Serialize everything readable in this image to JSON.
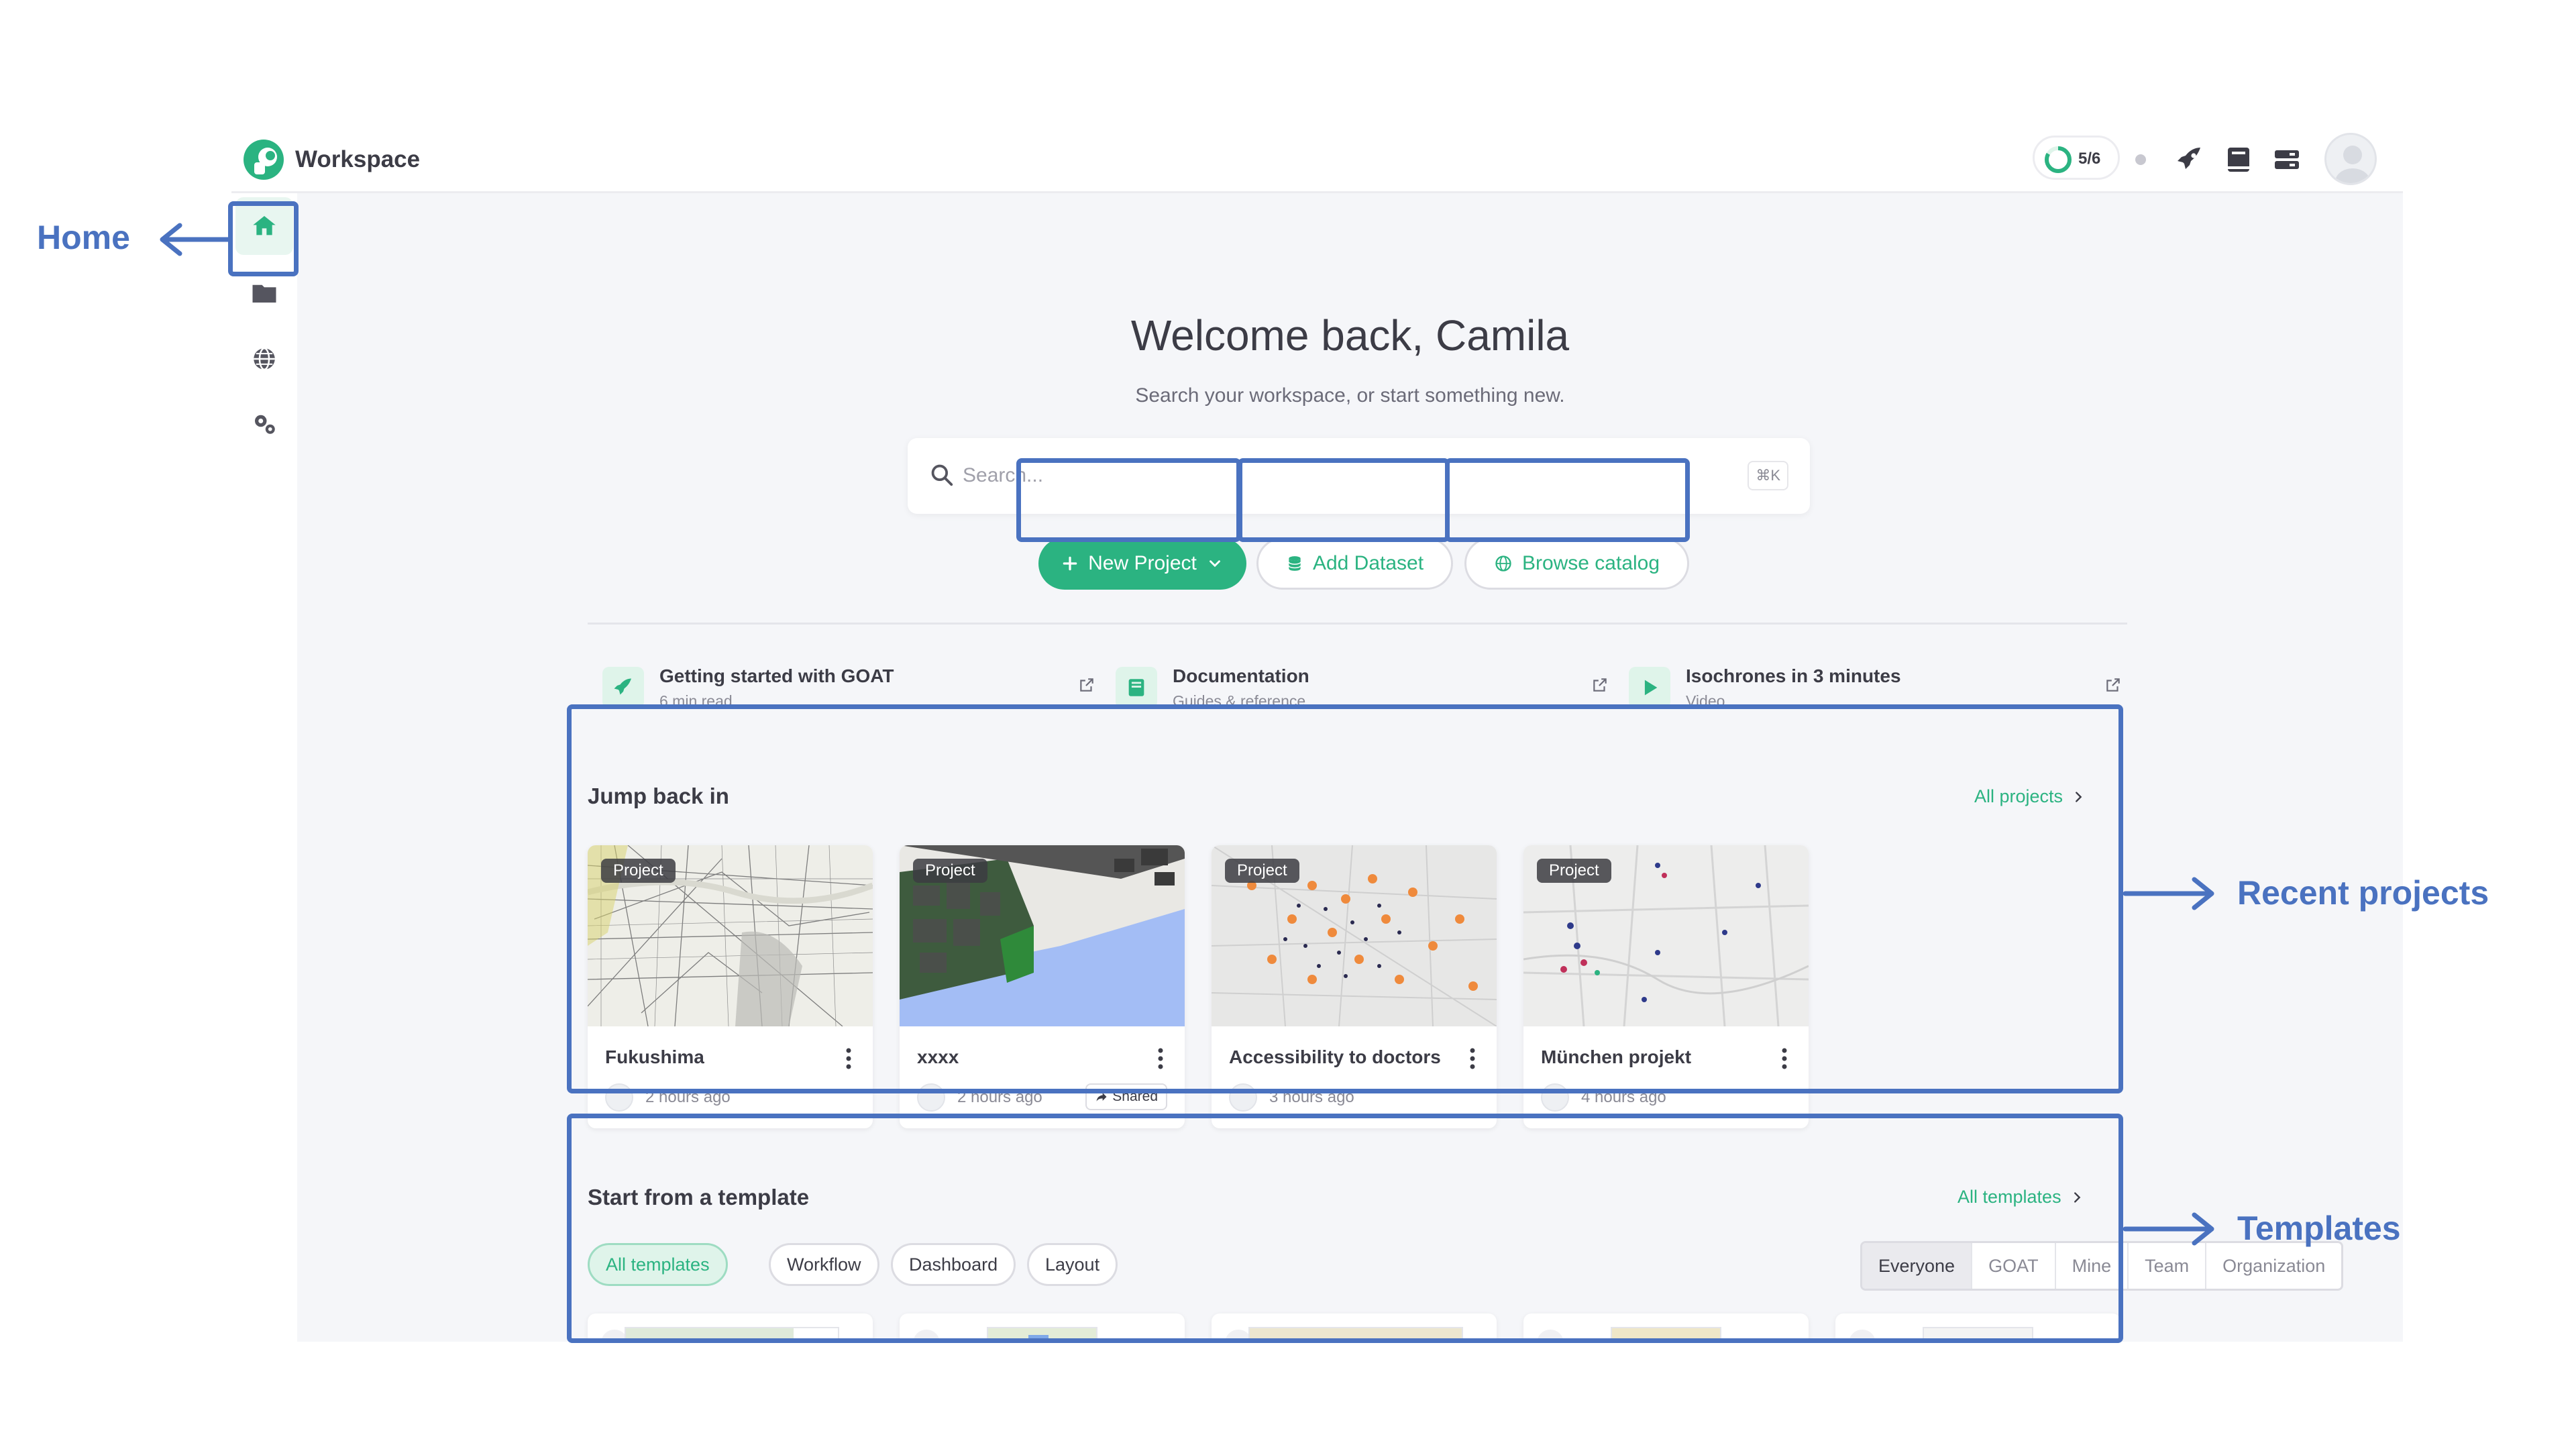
{
  "app": {
    "name": "Workspace",
    "progress": "5/6",
    "progress_fraction": 0.83
  },
  "topbar": {
    "icons": [
      "rocket-icon",
      "book-icon",
      "server-icon"
    ]
  },
  "sidebar": {
    "items": [
      {
        "name": "home",
        "icon": "home-icon",
        "active": true
      },
      {
        "name": "projects",
        "icon": "folder-icon"
      },
      {
        "name": "catalog",
        "icon": "globe-icon"
      },
      {
        "name": "settings",
        "icon": "gears-icon"
      }
    ]
  },
  "hero": {
    "title": "Welcome back, Camila",
    "subtitle": "Search your workspace, or start something new.",
    "search_placeholder": "Search...",
    "search_shortcut": "⌘K"
  },
  "actions": {
    "new_project": "New Project",
    "add_dataset": "Add Dataset",
    "browse_catalog": "Browse catalog"
  },
  "resources": [
    {
      "title": "Getting started with GOAT",
      "subtitle": "6 min read",
      "icon": "rocket-icon"
    },
    {
      "title": "Documentation",
      "subtitle": "Guides & reference",
      "icon": "book-icon"
    },
    {
      "title": "Isochrones in 3 minutes",
      "subtitle": "Video",
      "icon": "play-icon"
    }
  ],
  "recent": {
    "title": "Jump back in",
    "link": "All projects",
    "badge": "Project",
    "projects": [
      {
        "title": "Fukushima",
        "time": "2 hours ago",
        "shared": false
      },
      {
        "title": "xxxx",
        "time": "2 hours ago",
        "shared": true,
        "shared_label": "Shared"
      },
      {
        "title": "Accessibility to doctors",
        "time": "3 hours ago",
        "shared": false
      },
      {
        "title": "München projekt",
        "time": "4 hours ago",
        "shared": false
      }
    ]
  },
  "templates": {
    "title": "Start from a template",
    "link": "All templates",
    "chips": [
      "All templates",
      "Workflow",
      "Dashboard",
      "Layout"
    ],
    "active_chip": "All templates",
    "scopes": [
      "Everyone",
      "GOAT",
      "Mine",
      "Team",
      "Organization"
    ],
    "active_scope": "Everyone"
  },
  "annotations": {
    "home": "Home",
    "recent": "Recent projects",
    "templates": "Templates",
    "color": "#4a72c0"
  },
  "colors": {
    "brand": "#2bb381",
    "annotation": "#4a72c0",
    "background": "#f5f6f9"
  }
}
